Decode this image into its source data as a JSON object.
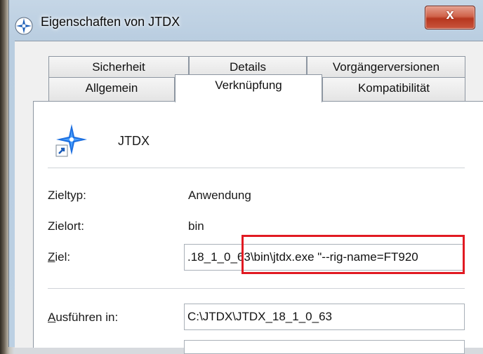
{
  "window": {
    "title": "Eigenschaften von JTDX",
    "close_label": "x"
  },
  "tabs": {
    "row1": [
      "Sicherheit",
      "Details",
      "Vorgängerversionen"
    ],
    "row2": [
      "Allgemein",
      "Verknüpfung",
      "Kompatibilität"
    ],
    "active": "Verknüpfung"
  },
  "shortcut": {
    "name": "JTDX"
  },
  "fields": {
    "zieltyp_label": "Zieltyp:",
    "zieltyp_value": "Anwendung",
    "zielort_label": "Zielort:",
    "zielort_value": "bin",
    "ziel_label_mnemonic": "Z",
    "ziel_label_rest": "iel:",
    "ziel_value": ".18_1_0_63\\bin\\jtdx.exe \"--rig-name=FT920",
    "ausfuehren_label_mnemonic": "A",
    "ausfuehren_label_rest": "usführen in:",
    "ausfuehren_value": "C:\\JTDX\\JTDX_18_1_0_63"
  },
  "colors": {
    "highlight": "#e11a22",
    "close_button": "#c8543c"
  }
}
